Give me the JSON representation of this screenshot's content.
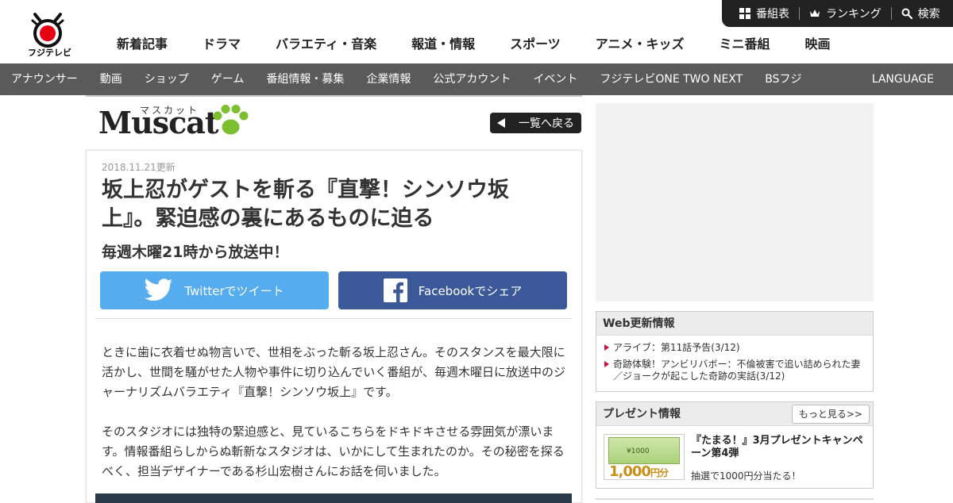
{
  "header": {
    "logo_text": "フジテレビ",
    "utility": [
      {
        "label": "番組表",
        "icon": "grid-icon"
      },
      {
        "label": "ランキング",
        "icon": "crown-icon"
      },
      {
        "label": "検索",
        "icon": "search-icon"
      }
    ],
    "main_nav": [
      "新着記事",
      "ドラマ",
      "バラエティ・音楽",
      "報道・情報",
      "スポーツ",
      "アニメ・キッズ",
      "ミニ番組",
      "映画"
    ]
  },
  "subnav": {
    "items": [
      "アナウンサー",
      "動画",
      "ショップ",
      "ゲーム",
      "番組情報・募集",
      "企業情報",
      "公式アカウント",
      "イベント",
      "フジテレビONE TWO NEXT",
      "BSフジ"
    ],
    "language": "LANGUAGE"
  },
  "muscat": {
    "kana": "マスカット",
    "word": "Muscat",
    "back_label": "一覧へ戻る"
  },
  "article": {
    "date": "2018.11.21更新",
    "title": "坂上忍がゲストを斬る『直撃！シンソウ坂上』。緊迫感の裏にあるものに迫る",
    "subtitle": "毎週木曜21時から放送中！",
    "twitter_label": "Twitterでツイート",
    "facebook_label": "Facebookでシェア",
    "paragraph1": "ときに歯に衣着せぬ物言いで、世相をぶった斬る坂上忍さん。そのスタンスを最大限に活かし、世間を騒がせた人物や事件に切り込んでいく番組が、毎週木曜日に放送中のジャーナリズムバラエティ『直撃！シンソウ坂上』です。",
    "paragraph2": "そのスタジオには独特の緊迫感と、見ているこちらをドキドキさせる雰囲気が漂います。情報番組らしからぬ斬新なスタジオは、いかにして生まれたのか。その秘密を探るべく、担当デザイナーである杉山宏樹さんにお話を伺いました。"
  },
  "sidebar": {
    "web_title": "Web更新情報",
    "web_items": [
      "アライブ：第11話予告(3/12)",
      "奇跡体験！アンビリバボー：不倫被害で追い詰められた妻／ジョークが起こした奇跡の実話(3/12)"
    ],
    "present_title": "プレゼント情報",
    "more_label": "もっと見る>>",
    "present_item_title": "『たまる！』3月プレゼントキャンペーン第4弾",
    "present_item_desc": "抽選で1000円分当たる！",
    "voucher_label": "¥1000",
    "voucher_price": "1,000",
    "voucher_unit": "円分"
  },
  "colors": {
    "twitter": "#55acee",
    "facebook": "#3b5998",
    "subnav_bg": "#5a5a5a",
    "utility_bg": "#222222",
    "muscat_green": "#7dc02f",
    "logo_red": "#e60012"
  }
}
